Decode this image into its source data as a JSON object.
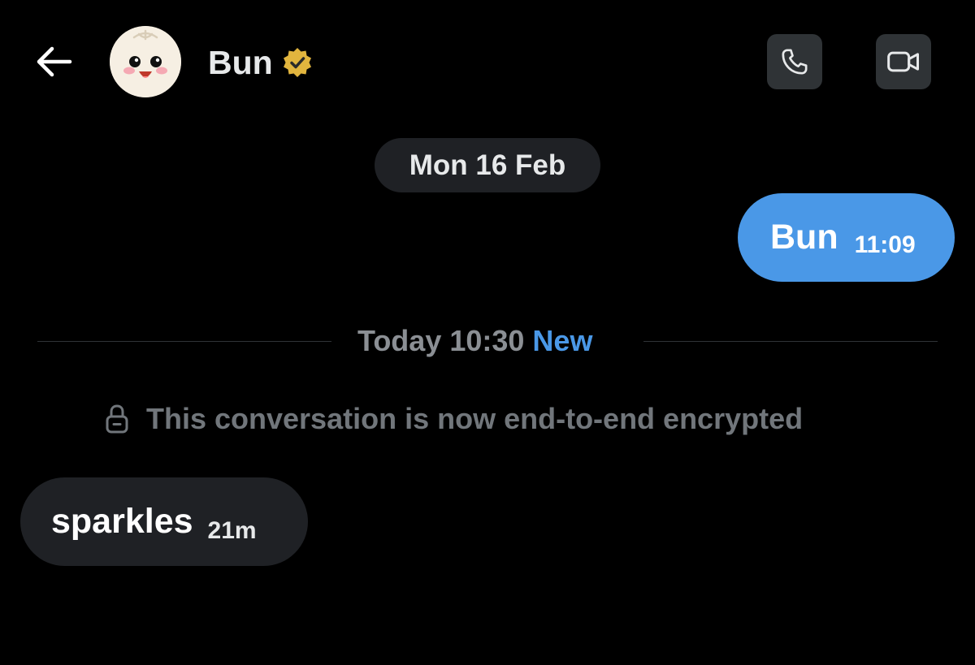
{
  "header": {
    "contact_name": "Bun",
    "back_icon": "arrow-left-icon",
    "verified_icon": "verified-badge-icon",
    "call_icon": "phone-icon",
    "video_icon": "video-camera-icon"
  },
  "conversation": {
    "date_separator": "Mon 16 Feb",
    "messages": [
      {
        "direction": "sent",
        "text": "Bun",
        "time": "11:09"
      },
      {
        "direction": "received",
        "text": "sparkles",
        "time": "21m"
      }
    ],
    "new_divider": {
      "time": "Today 10:30",
      "badge": "New"
    },
    "encryption_notice": "This conversation is now end-to-end encrypted",
    "encryption_icon": "lock-icon"
  },
  "colors": {
    "background": "#000000",
    "sent_bubble": "#4a98e7",
    "received_bubble": "#1f2125",
    "accent": "#4a98e7",
    "verified_gold": "#e2b53e"
  }
}
